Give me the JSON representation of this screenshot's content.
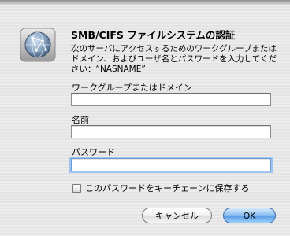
{
  "dialog": {
    "title": "SMB/CIFS ファイルシステムの認証",
    "message": "次のサーバにアクセスするためのワークグループまたはドメイン、およびユーザ名とパスワードを入力してください：“NASNAME”",
    "icon": "network-globe-icon"
  },
  "fields": {
    "workgroup": {
      "label": "ワークグループまたはドメイン",
      "value": ""
    },
    "name": {
      "label": "名前",
      "value": ""
    },
    "password": {
      "label": "パスワード",
      "value": ""
    }
  },
  "keychain_checkbox": {
    "label": "このパスワードをキーチェーンに保存する",
    "checked": false
  },
  "buttons": {
    "cancel": "キャンセル",
    "ok": "OK"
  },
  "colors": {
    "ok_button": "#5a9de6",
    "focus_ring": "#9ec4f0",
    "background": "#ececec"
  }
}
